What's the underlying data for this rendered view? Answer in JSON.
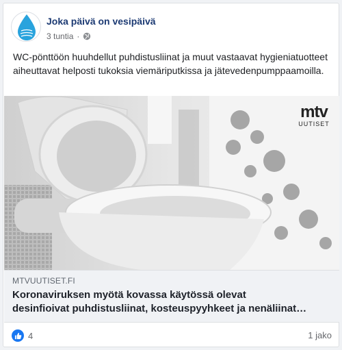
{
  "post": {
    "page_name": "Joka päivä on vesipäivä",
    "time": "3 tuntia",
    "privacy_icon": "globe-icon",
    "avatar_text": "Joka päivä on vesipäivä",
    "text": "WC-pönttöön huuhdellut puhdistusliinat ja muut vastaavat hygieniatuotteet aiheuttavat helposti tukoksia viemäriputkissa ja jätevedenpumppaamoilla."
  },
  "image": {
    "logo_top": "mtv",
    "logo_bottom": "UUTISET"
  },
  "link": {
    "domain": "MTVUUTISET.FI",
    "title_line1": "Koronaviruksen myötä kovassa käytössä olevat",
    "title_line2": "desinfioivat puhdistusliinat, kosteuspyyhkeet ja nenäliinat…"
  },
  "footer": {
    "reaction_icon": "like-icon",
    "reaction_count": "4",
    "shares": "1 jako"
  },
  "colors": {
    "brand_blue": "#1877f2",
    "page_name": "#1c3a73",
    "drop_blue": "#29a3dd"
  }
}
